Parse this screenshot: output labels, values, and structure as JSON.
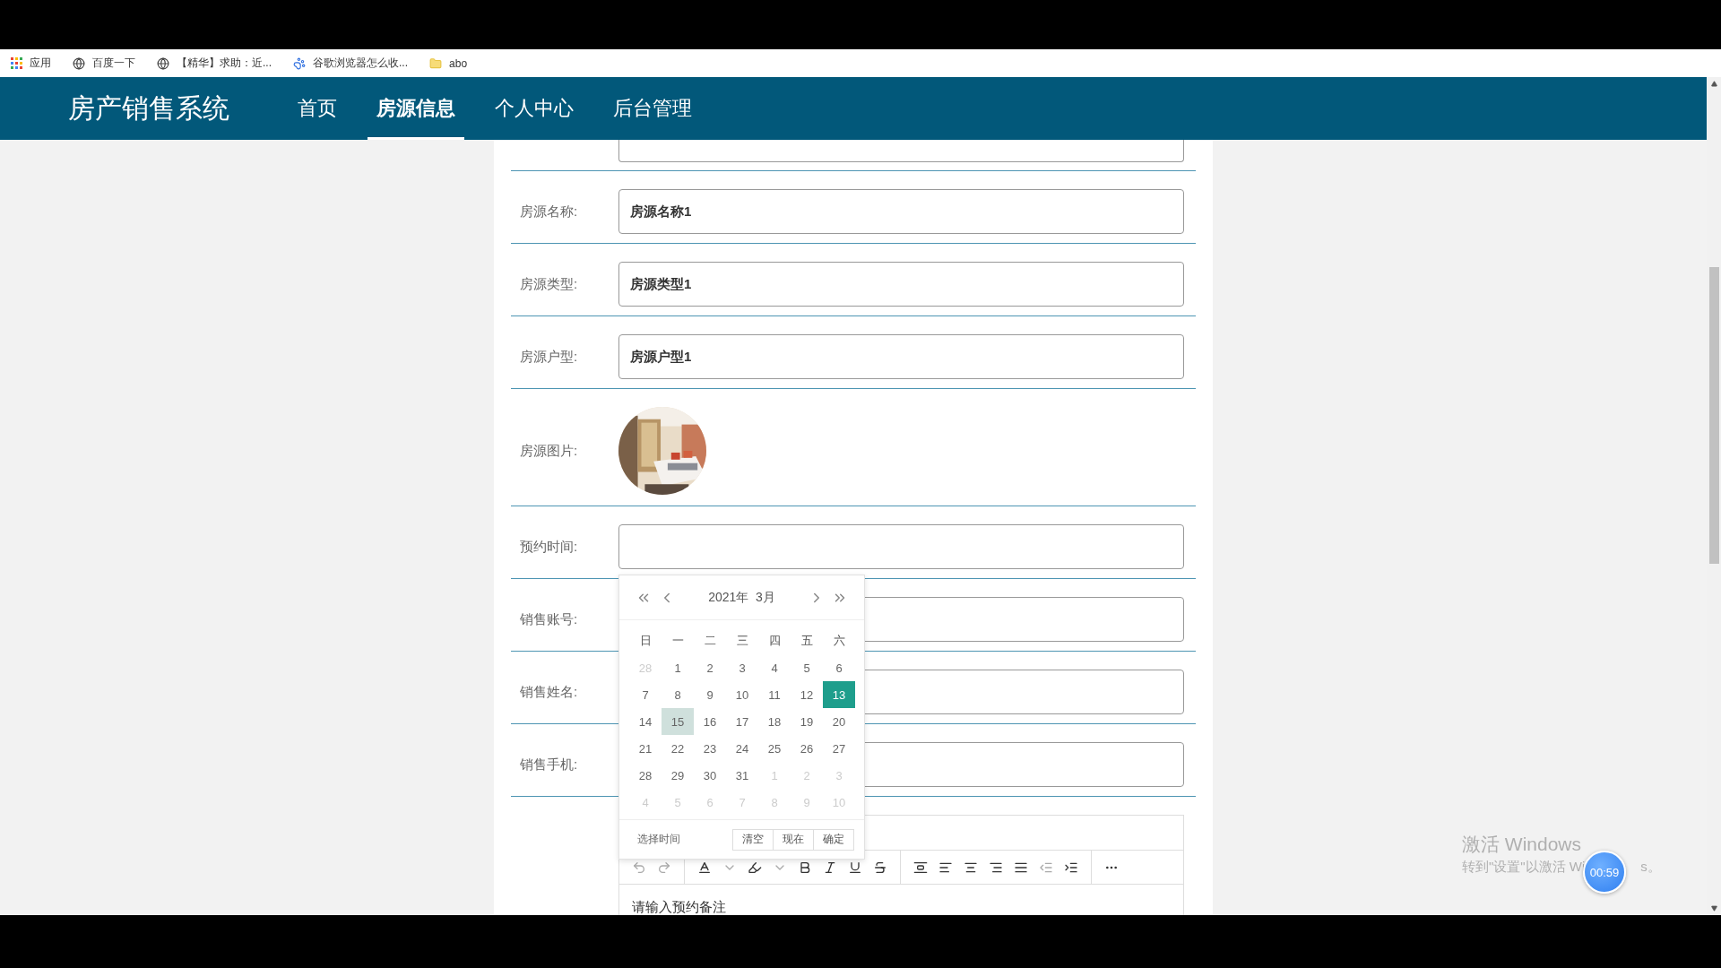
{
  "bookmarks": [
    {
      "kind": "apps",
      "label": "应用"
    },
    {
      "kind": "globe",
      "label": "百度一下"
    },
    {
      "kind": "globe",
      "label": "【精华】求助：近..."
    },
    {
      "kind": "paw",
      "label": "谷歌浏览器怎么收..."
    },
    {
      "kind": "folder",
      "label": "abo"
    }
  ],
  "nav": {
    "brand": "房产销售系统",
    "items": [
      {
        "label": "首页",
        "selected": false
      },
      {
        "label": "房源信息",
        "selected": true
      },
      {
        "label": "个人中心",
        "selected": false
      },
      {
        "label": "后台管理",
        "selected": false
      }
    ]
  },
  "form": {
    "rows": [
      {
        "kind": "input",
        "label": "房源名称:",
        "value": "房源名称1"
      },
      {
        "kind": "input",
        "label": "房源类型:",
        "value": "房源类型1"
      },
      {
        "kind": "input",
        "label": "房源户型:",
        "value": "房源户型1"
      },
      {
        "label": "房源图片:"
      },
      {
        "kind": "date",
        "label": "预约时间:",
        "value": ""
      },
      {
        "kind": "input",
        "label": "销售账号:",
        "value": ""
      },
      {
        "kind": "input",
        "label": "销售姓名:",
        "value": ""
      },
      {
        "kind": "input",
        "label": "销售手机:",
        "value": ""
      }
    ],
    "editor": {
      "placeholder": "请输入预约备注"
    }
  },
  "calendar": {
    "title": "2021年  3月",
    "weekdays": [
      "日",
      "一",
      "二",
      "三",
      "四",
      "五",
      "六"
    ],
    "days": [
      {
        "label": "28",
        "current": false,
        "selected": false,
        "hovered": false
      },
      {
        "label": "1",
        "current": true,
        "selected": false,
        "hovered": false
      },
      {
        "label": "2",
        "current": true,
        "selected": false,
        "hovered": false
      },
      {
        "label": "3",
        "current": true,
        "selected": false,
        "hovered": false
      },
      {
        "label": "4",
        "current": true,
        "selected": false,
        "hovered": false
      },
      {
        "label": "5",
        "current": true,
        "selected": false,
        "hovered": false
      },
      {
        "label": "6",
        "current": true,
        "selected": false,
        "hovered": false
      },
      {
        "label": "7",
        "current": true,
        "selected": false,
        "hovered": false
      },
      {
        "label": "8",
        "current": true,
        "selected": false,
        "hovered": false
      },
      {
        "label": "9",
        "current": true,
        "selected": false,
        "hovered": false
      },
      {
        "label": "10",
        "current": true,
        "selected": false,
        "hovered": false
      },
      {
        "label": "11",
        "current": true,
        "selected": false,
        "hovered": false
      },
      {
        "label": "12",
        "current": true,
        "selected": false,
        "hovered": false
      },
      {
        "label": "13",
        "current": true,
        "selected": true,
        "hovered": false
      },
      {
        "label": "14",
        "current": true,
        "selected": false,
        "hovered": false
      },
      {
        "label": "15",
        "current": true,
        "selected": false,
        "hovered": true
      },
      {
        "label": "16",
        "current": true,
        "selected": false,
        "hovered": false
      },
      {
        "label": "17",
        "current": true,
        "selected": false,
        "hovered": false
      },
      {
        "label": "18",
        "current": true,
        "selected": false,
        "hovered": false
      },
      {
        "label": "19",
        "current": true,
        "selected": false,
        "hovered": false
      },
      {
        "label": "20",
        "current": true,
        "selected": false,
        "hovered": false
      },
      {
        "label": "21",
        "current": true,
        "selected": false,
        "hovered": false
      },
      {
        "label": "22",
        "current": true,
        "selected": false,
        "hovered": false
      },
      {
        "label": "23",
        "current": true,
        "selected": false,
        "hovered": false
      },
      {
        "label": "24",
        "current": true,
        "selected": false,
        "hovered": false
      },
      {
        "label": "25",
        "current": true,
        "selected": false,
        "hovered": false
      },
      {
        "label": "26",
        "current": true,
        "selected": false,
        "hovered": false
      },
      {
        "label": "27",
        "current": true,
        "selected": false,
        "hovered": false
      },
      {
        "label": "28",
        "current": true,
        "selected": false,
        "hovered": false
      },
      {
        "label": "29",
        "current": true,
        "selected": false,
        "hovered": false
      },
      {
        "label": "30",
        "current": true,
        "selected": false,
        "hovered": false
      },
      {
        "label": "31",
        "current": true,
        "selected": false,
        "hovered": false
      },
      {
        "label": "1",
        "current": false,
        "selected": false,
        "hovered": false
      },
      {
        "label": "2",
        "current": false,
        "selected": false,
        "hovered": false
      },
      {
        "label": "3",
        "current": false,
        "selected": false,
        "hovered": false
      },
      {
        "label": "4",
        "current": false,
        "selected": false,
        "hovered": false
      },
      {
        "label": "5",
        "current": false,
        "selected": false,
        "hovered": false
      },
      {
        "label": "6",
        "current": false,
        "selected": false,
        "hovered": false
      },
      {
        "label": "7",
        "current": false,
        "selected": false,
        "hovered": false
      },
      {
        "label": "8",
        "current": false,
        "selected": false,
        "hovered": false
      },
      {
        "label": "9",
        "current": false,
        "selected": false,
        "hovered": false
      },
      {
        "label": "10",
        "current": false,
        "selected": false,
        "hovered": false
      }
    ],
    "footer_label": "选择时间",
    "buttons": [
      "清空",
      "现在",
      "确定"
    ]
  },
  "watermark": {
    "title": "激活 Windows",
    "subtitle": [
      "转到\"设置\"以激活 Wi",
      "s。"
    ]
  },
  "timer": "00:59"
}
